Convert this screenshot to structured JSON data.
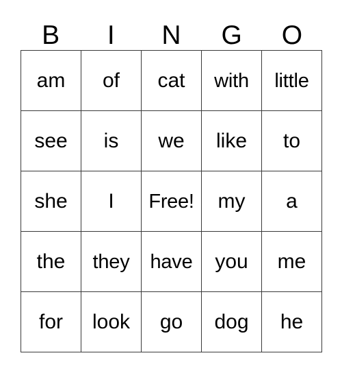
{
  "card": {
    "title": "BINGO",
    "header": {
      "letters": [
        "B",
        "I",
        "N",
        "G",
        "O"
      ]
    },
    "grid": {
      "columns": 5,
      "rows": 5,
      "free_space_label": "Free!",
      "free_space_position": {
        "row": 3,
        "column": 3
      },
      "cells": [
        [
          {
            "text": "am"
          },
          {
            "text": "of"
          },
          {
            "text": "cat"
          },
          {
            "text": "with"
          },
          {
            "text": "little"
          }
        ],
        [
          {
            "text": "see"
          },
          {
            "text": "is"
          },
          {
            "text": "we"
          },
          {
            "text": "like"
          },
          {
            "text": "to"
          }
        ],
        [
          {
            "text": "she"
          },
          {
            "text": "I"
          },
          {
            "text": "Free!"
          },
          {
            "text": "my"
          },
          {
            "text": "a"
          }
        ],
        [
          {
            "text": "the"
          },
          {
            "text": "they"
          },
          {
            "text": "have"
          },
          {
            "text": "you"
          },
          {
            "text": "me"
          }
        ],
        [
          {
            "text": "for"
          },
          {
            "text": "look"
          },
          {
            "text": "go"
          },
          {
            "text": "dog"
          },
          {
            "text": "he"
          }
        ]
      ]
    },
    "colors": {
      "background": "#ffffff",
      "text": "#000000",
      "grid_line": "#3a3a3a"
    }
  }
}
